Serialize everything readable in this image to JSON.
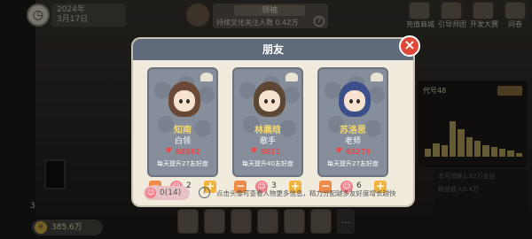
{
  "hud": {
    "date_line1": "2024年",
    "date_line2": "3月17日",
    "banner_title": "领袖",
    "banner_text": "持续文化关注人数",
    "banner_value": "0.42万",
    "help": "?",
    "top_icons": [
      {
        "label": "充值商城",
        "icon": "shop-icon"
      },
      {
        "label": "引导师团",
        "icon": "gift-icon"
      },
      {
        "label": "开发大赛",
        "icon": "trophy-icon"
      },
      {
        "label": "问卷",
        "icon": "survey-icon"
      }
    ],
    "money": "385.6万",
    "coin_symbol": "¥",
    "left_count": "3",
    "more_button": "…"
  },
  "right_panel": {
    "code": "代号48",
    "bar_levels": [
      0.2,
      0.35,
      0.3,
      0.9,
      0.7,
      0.5,
      0.4,
      0.3,
      0.25,
      0.2,
      0.15,
      0.1
    ],
    "notes": [
      "本月消耗1.32万支出",
      "粉丝收入0.4万"
    ]
  },
  "modal": {
    "title": "朋友",
    "close": "×",
    "cards": [
      {
        "name": "知南",
        "job": "白领",
        "favor": "88382",
        "daily": "每天提升27友好度",
        "count": "2",
        "hair_color": "#6a4a36"
      },
      {
        "name": "林晨晗",
        "job": "歌手",
        "favor": "9811",
        "daily": "每天提升40友好度",
        "count": "3",
        "hair_color": "#5d4634"
      },
      {
        "name": "苏洛思",
        "job": "老师",
        "favor": "63279",
        "daily": "每天提升27友好度",
        "count": "6",
        "hair_color": "#3b4f8a"
      }
    ],
    "points": "0(14)",
    "hint": "点击头像可查看人物更多信息，精力分配越多友好度增长越快",
    "colors": {
      "header": "#5f6a7a",
      "card": "#868e9c",
      "name": "#f3d66a",
      "heart": "#e84a4a",
      "close": "#e0473b"
    }
  }
}
